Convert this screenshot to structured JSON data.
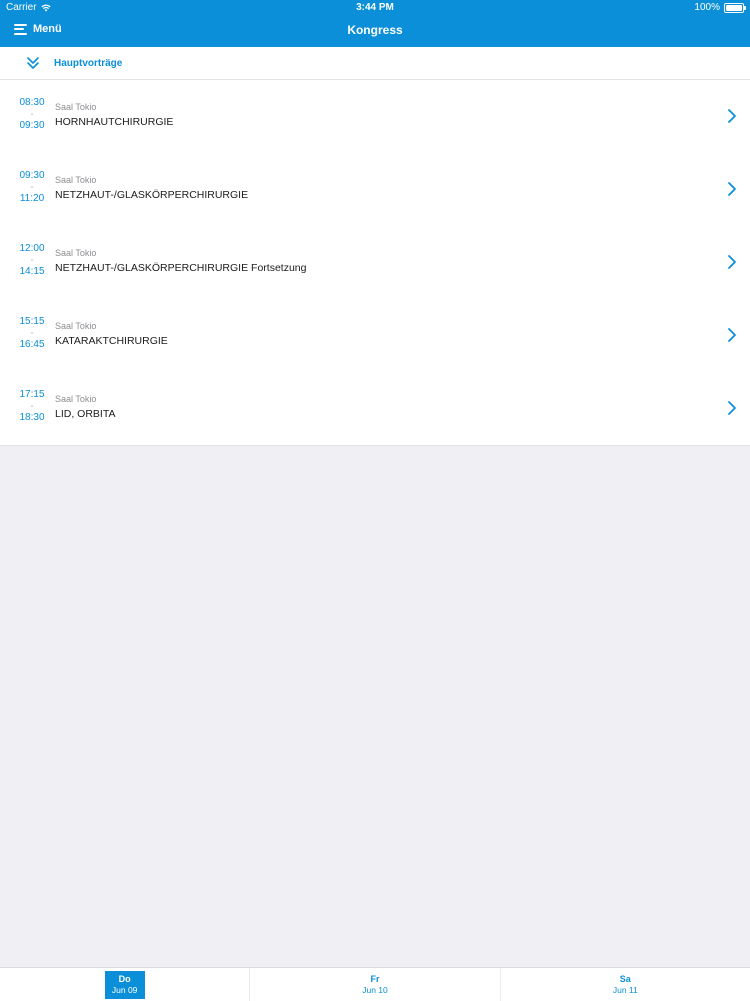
{
  "status_bar": {
    "carrier": "Carrier",
    "time": "3:44 PM",
    "battery": "100%"
  },
  "nav": {
    "menu_label": "Menü",
    "title": "Kongress"
  },
  "section": {
    "label": "Hauptvorträge"
  },
  "sessions": [
    {
      "start": "08:30",
      "separator": "-",
      "end": "09:30",
      "room": "Saal Tokio",
      "title": "HORNHAUTCHIRURGIE"
    },
    {
      "start": "09:30",
      "separator": "-",
      "end": "11:20",
      "room": "Saal Tokio",
      "title": "NETZHAUT-/GLASKÖRPERCHIRURGIE"
    },
    {
      "start": "12:00",
      "separator": "-",
      "end": "14:15",
      "room": "Saal Tokio",
      "title": "NETZHAUT-/GLASKÖRPERCHIRURGIE Fortsetzung"
    },
    {
      "start": "15:15",
      "separator": "-",
      "end": "16:45",
      "room": "Saal Tokio",
      "title": "KATARAKTCHIRURGIE"
    },
    {
      "start": "17:15",
      "separator": "-",
      "end": "18:30",
      "room": "Saal Tokio",
      "title": "LID, ORBITA"
    }
  ],
  "tabs": [
    {
      "day": "Do",
      "date": "Jun 09",
      "active": true
    },
    {
      "day": "Fr",
      "date": "Jun 10",
      "active": false
    },
    {
      "day": "Sa",
      "date": "Jun 11",
      "active": false
    }
  ],
  "colors": {
    "accent": "#0b8fd8",
    "background": "#f0eff4"
  }
}
